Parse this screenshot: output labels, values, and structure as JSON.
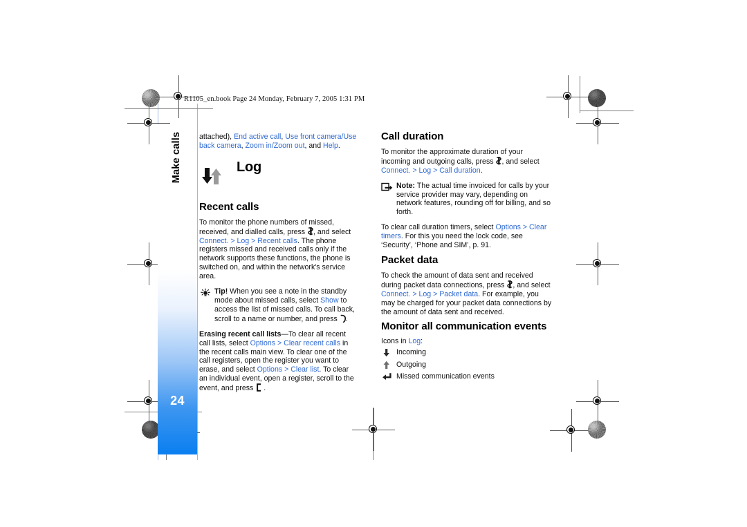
{
  "print_header": "R1105_en.book  Page 24  Monday, February 7, 2005  1:31 PM",
  "sidebar": {
    "tab_label": "Make calls",
    "page_number": "24",
    "accent_color": "#0a7ff0"
  },
  "link_color": "#2f6ad2",
  "left_column": {
    "continued_paragraph": {
      "seg1": "attached), ",
      "link1": "End active call",
      "seg2": ", ",
      "link2": "Use front camera",
      "seg3": "/",
      "link3": "Use back camera",
      "seg4": ", ",
      "link4": "Zoom in",
      "seg5": "/",
      "link5": "Zoom out",
      "seg6": ", and ",
      "link6": "Help",
      "seg7": "."
    },
    "log_heading": "Log",
    "log_icon": "incoming-outgoing-arrows-icon",
    "recent_calls": {
      "heading": "Recent calls",
      "body_seg1": "To monitor the phone numbers of missed, received, and dialled calls, press ",
      "body_key_icon": "menu-key-icon",
      "body_seg2": ", and select ",
      "body_link1": "Connect. > Log > Recent calls",
      "body_seg3": ". The phone registers missed and received calls only if the network supports these functions, the phone is switched on, and within the network's service area."
    },
    "tip": {
      "icon": "tip-lightbulb-icon",
      "label": "Tip!",
      "seg1": " When you see a note in the standby mode about missed calls, select ",
      "link1": "Show",
      "seg2": " to access the list of missed calls. To call back, scroll to a name or number, and press ",
      "key_icon": "call-key-icon",
      "seg3": "."
    },
    "erasing": {
      "bold_label": "Erasing recent call lists",
      "seg1": "—To clear all recent call lists, select ",
      "link1": "Options > Clear recent calls",
      "seg2": " in the recent calls main view. To clear one of the call registers, open the register you want to erase, and select ",
      "link2": "Options > Clear list",
      "seg3": ". To clear an individual event, open a register, scroll to the event, and press ",
      "key_icon": "clear-key-icon",
      "seg4": " ."
    }
  },
  "right_column": {
    "call_duration": {
      "heading": "Call duration",
      "seg1": "To monitor the approximate duration of your incoming and outgoing calls, press ",
      "key_icon": "menu-key-icon",
      "seg2": ", and select ",
      "link1": "Connect. > Log > Call duration",
      "seg3": "."
    },
    "note": {
      "icon": "note-arrow-icon",
      "label": "Note:",
      "text": " The actual time invoiced for calls by your service provider may vary, depending on network features, rounding off for billing, and so forth."
    },
    "clear_timers": {
      "seg1": "To clear call duration timers, select ",
      "link1": "Options > Clear timers",
      "seg2": ". For this you need the lock code, see ‘Security’, ‘Phone and SIM’, p. 91."
    },
    "packet_data": {
      "heading": "Packet data",
      "seg1": "To check the amount of data sent and received during packet data connections, press ",
      "key_icon": "menu-key-icon",
      "seg2": ", and select ",
      "link1": "Connect. > Log > Packet data",
      "seg3": ". For example, you may be charged for your packet data connections by the amount of data sent and received."
    },
    "monitor_events": {
      "heading": "Monitor all communication events",
      "intro_seg1": "Icons in ",
      "intro_link": "Log",
      "intro_seg2": ":",
      "items": [
        {
          "icon": "incoming-arrow-icon",
          "label": "Incoming"
        },
        {
          "icon": "outgoing-arrow-icon",
          "label": "Outgoing"
        },
        {
          "icon": "missed-event-arrow-icon",
          "label": "Missed communication events"
        }
      ]
    }
  }
}
